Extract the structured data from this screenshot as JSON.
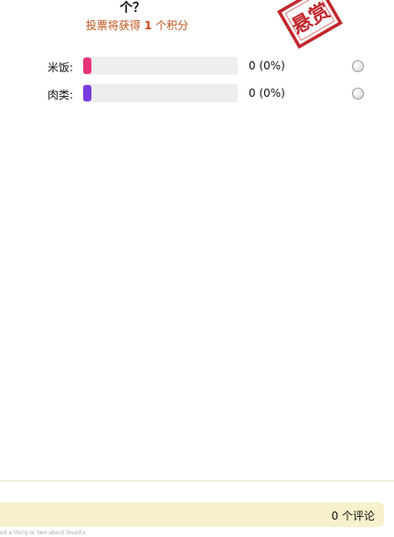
{
  "question": {
    "title_tail": "个？"
  },
  "reward": {
    "prefix": "投票将获得",
    "points": "1",
    "suffix": "个积分"
  },
  "stamp": {
    "text": "悬赏",
    "color": "#c0282d"
  },
  "poll": {
    "options": [
      {
        "label": "米饭:",
        "result": "0 (0%)",
        "color": "#e8337a",
        "fraction": 0
      },
      {
        "label": "肉类:",
        "result": "0 (0%)",
        "color": "#7a3be0",
        "fraction": 0
      }
    ]
  },
  "comments": {
    "count_label": "0 个评论"
  },
  "footer": {
    "text": "ed a thing or two about loved's"
  }
}
